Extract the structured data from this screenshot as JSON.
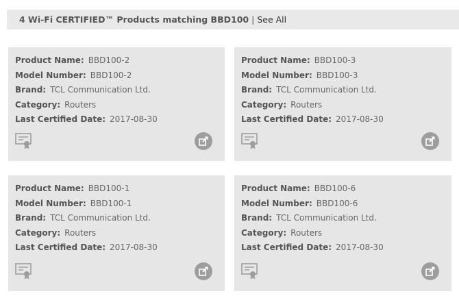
{
  "header": {
    "title": "4 Wi-Fi CERTIFIED™ Products matching BBD100",
    "separator": "|",
    "see_all": "See All"
  },
  "labels": {
    "product_name": "Product Name:",
    "model_number": "Model Number:",
    "brand": "Brand:",
    "category": "Category:",
    "last_certified": "Last Certified Date:"
  },
  "products": [
    {
      "product_name": "BBD100-2",
      "model_number": "BBD100-2",
      "brand": "TCL Communication Ltd.",
      "category": "Routers",
      "last_certified": "2017-08-30"
    },
    {
      "product_name": "BBD100-3",
      "model_number": "BBD100-3",
      "brand": "TCL Communication Ltd.",
      "category": "Routers",
      "last_certified": "2017-08-30"
    },
    {
      "product_name": "BBD100-1",
      "model_number": "BBD100-1",
      "brand": "TCL Communication Ltd.",
      "category": "Routers",
      "last_certified": "2017-08-30"
    },
    {
      "product_name": "BBD100-6",
      "model_number": "BBD100-6",
      "brand": "TCL Communication Ltd.",
      "category": "Routers",
      "last_certified": "2017-08-30"
    }
  ],
  "icons": {
    "certificate": "certificate-icon",
    "external_link": "external-link-icon"
  },
  "colors": {
    "header_bg": "#e9e9e9",
    "card_bg": "#e6e6e6",
    "icon_gray": "#9d9d9d"
  }
}
